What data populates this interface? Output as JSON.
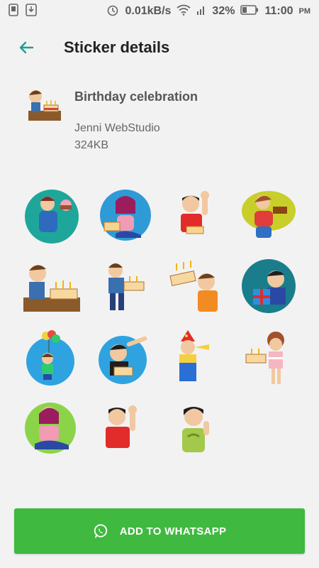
{
  "status_bar": {
    "speed": "0.01kB/s",
    "battery": "32%",
    "time": "11:00",
    "ampm": "PM"
  },
  "app_bar": {
    "title": "Sticker details"
  },
  "pack": {
    "name": "Birthday celebration",
    "publisher": "Jenni WebStudio",
    "size": "324KB"
  },
  "stickers": [
    {
      "icon": "man-with-cake-sticker"
    },
    {
      "icon": "girl-with-cake-sticker"
    },
    {
      "icon": "boy-waving-sticker"
    },
    {
      "icon": "woman-with-cake-sticker"
    },
    {
      "icon": "man-blowing-candles-sticker"
    },
    {
      "icon": "boy-holding-cake-sticker"
    },
    {
      "icon": "man-with-cake-sticker-2"
    },
    {
      "icon": "boy-with-gift-sticker"
    },
    {
      "icon": "girl-with-balloons-sticker"
    },
    {
      "icon": "man-pointing-sticker"
    },
    {
      "icon": "boy-party-hat-sticker"
    },
    {
      "icon": "girl-with-cake-sticker-2"
    },
    {
      "icon": "girl-praying-sticker"
    },
    {
      "icon": "boy-waving-sticker-2"
    },
    {
      "icon": "boy-thumbs-sticker"
    }
  ],
  "add_button": {
    "label": "ADD TO WHATSAPP"
  },
  "colors": {
    "accent": "#3fb93f",
    "back_arrow": "#1f9e8f"
  }
}
